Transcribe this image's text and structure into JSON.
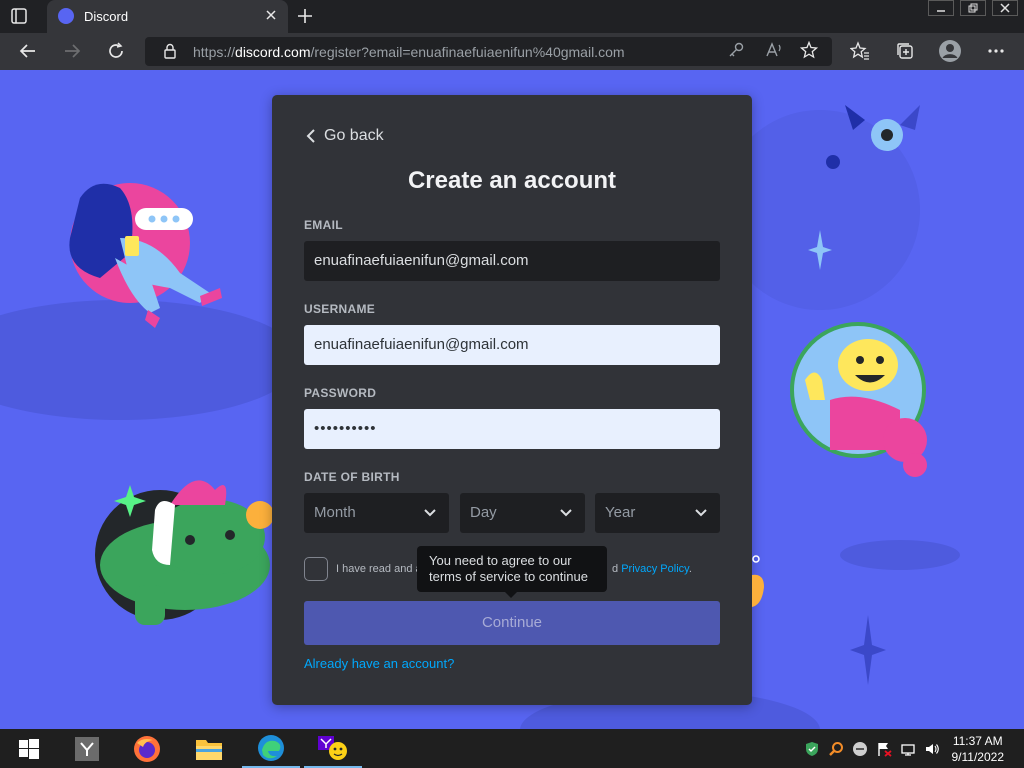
{
  "browser": {
    "tab_title": "Discord",
    "url_prefix": "https://",
    "url_host": "discord.com",
    "url_path": "/register?email=enuafinaefuiaenifun%40gmail.com"
  },
  "card": {
    "go_back": "Go back",
    "title": "Create an account",
    "email_label": "EMAIL",
    "email_value": "enuafinaefuiaenifun@gmail.com",
    "username_label": "USERNAME",
    "username_value": "enuafinaefuiaenifun@gmail.com",
    "password_label": "PASSWORD",
    "password_value": "••••••••••",
    "dob_label": "DATE OF BIRTH",
    "month_placeholder": "Month",
    "day_placeholder": "Day",
    "year_placeholder": "Year",
    "tos_text": "I have read and a",
    "tos_suffix": "d",
    "privacy_link": "Privacy Policy",
    "tos_end": ".",
    "tooltip": "You need to agree to our terms of service to continue",
    "continue_label": "Continue",
    "login_link": "Already have an account?"
  },
  "taskbar": {
    "time": "11:37 AM",
    "date": "9/11/2022",
    "apps": [
      "windows-start",
      "yahoo-y",
      "firefox",
      "file-explorer",
      "edge",
      "yahoo-messenger"
    ]
  },
  "colors": {
    "discord_blurple": "#5865f2",
    "card_bg": "#313338",
    "link": "#00a8fc"
  }
}
